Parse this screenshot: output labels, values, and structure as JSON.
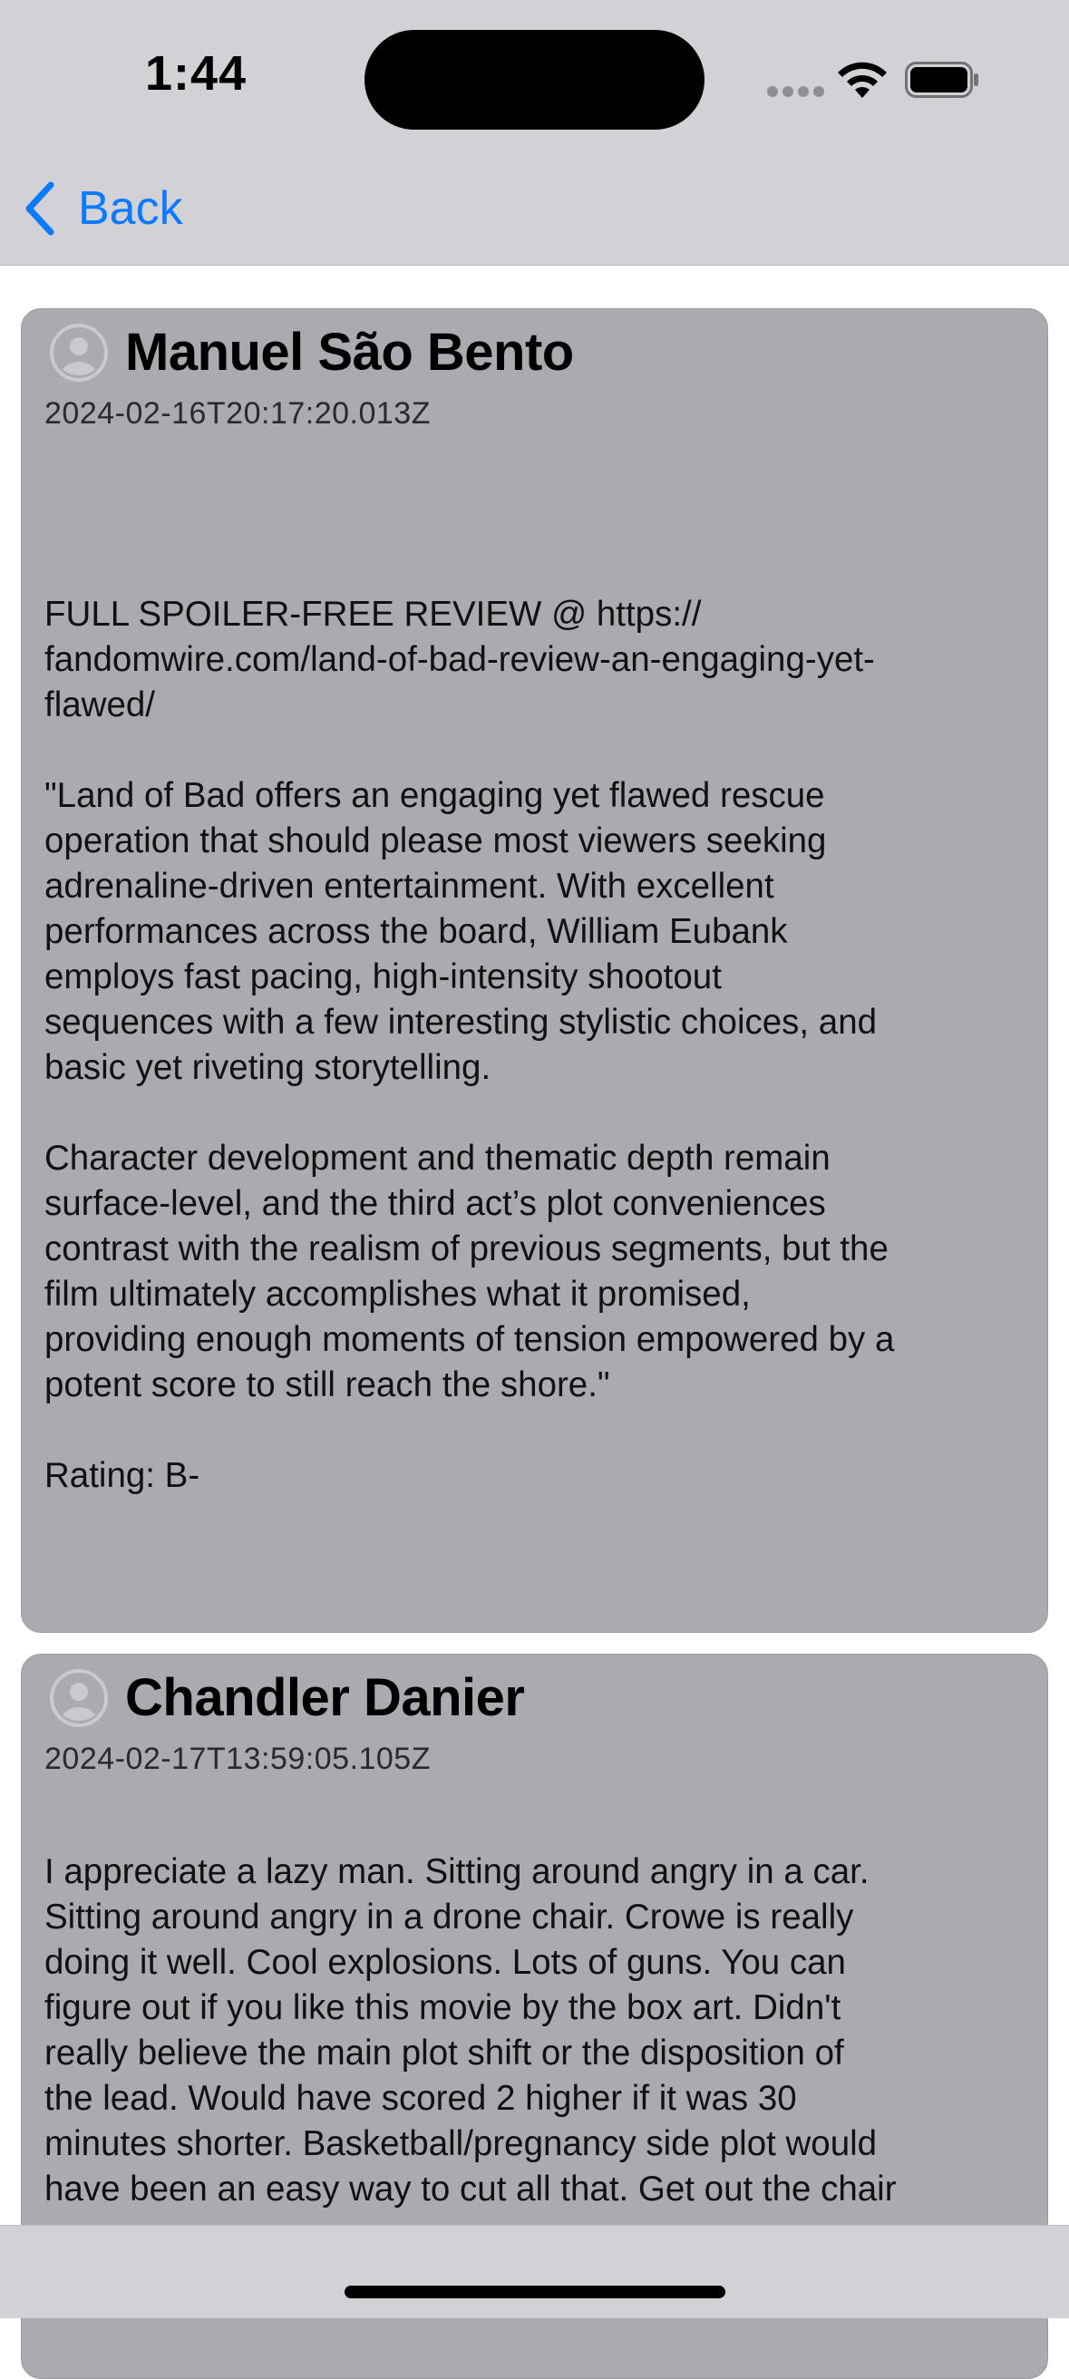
{
  "status_bar": {
    "time": "1:44"
  },
  "nav": {
    "back_label": "Back"
  },
  "reviews": [
    {
      "author": "Manuel São Bento",
      "timestamp": "2024-02-16T20:17:20.013Z",
      "content": "FULL SPOILER-FREE REVIEW @ https://\nfandomwire.com/land-of-bad-review-an-engaging-yet-\nflawed/\n\n\"Land of Bad offers an engaging yet flawed rescue\noperation that should please most viewers seeking\nadrenaline-driven entertainment. With excellent\nperformances across the board, William Eubank\nemploys fast pacing, high-intensity shootout\nsequences with a few interesting stylistic choices, and\nbasic yet riveting storytelling.\n\nCharacter development and thematic depth remain\nsurface-level, and the third act’s plot conveniences\ncontrast with the realism of previous segments, but the\nfilm ultimately accomplishes what it promised,\nproviding enough moments of tension empowered by a\npotent score to still reach the shore.\"\n\nRating: B-"
    },
    {
      "author": "Chandler Danier",
      "timestamp": "2024-02-17T13:59:05.105Z",
      "content": "I appreciate a lazy man. Sitting around angry in a car.\nSitting around angry in a drone chair. Crowe is really\ndoing it well. Cool explosions. Lots of guns. You can\nfigure out if you like this movie by the box art. Didn't\nreally believe the main plot shift or the disposition of\nthe lead. Would have scored 2 higher if it was 30\nminutes shorter. Basketball/pregnancy side plot would\nhave been an easy way to cut all that. Get out the chair"
    }
  ],
  "colors": {
    "accent": "#0a7aff",
    "card_background": "#abaab0",
    "bar_background": "#d1d1d6"
  }
}
